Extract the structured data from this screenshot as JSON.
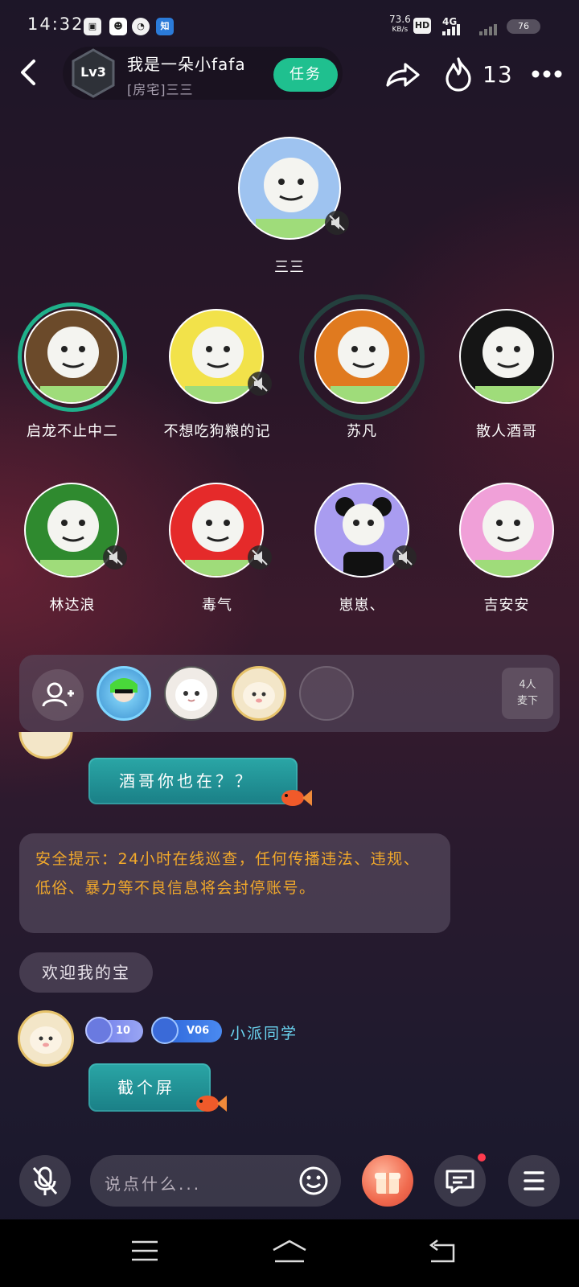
{
  "status_bar": {
    "time": "14:32",
    "net_speed": "73.6",
    "net_unit": "KB/s",
    "hd_label": "HD",
    "network_label": "4G",
    "battery": "76"
  },
  "header": {
    "level": "Lv3",
    "room_title": "我是一朵小fafa",
    "room_subtitle": "[房宅]三三",
    "task_label": "任务",
    "heat_count": "13"
  },
  "host": {
    "name": "三三"
  },
  "seats": [
    {
      "name": "启龙不止中二",
      "color": "#6b4a2a"
    },
    {
      "name": "不想吃狗粮的记",
      "color": "#f2e24a"
    },
    {
      "name": "苏凡",
      "color": "#e07a1f"
    },
    {
      "name": "散人酒哥",
      "color": "#151515"
    },
    {
      "name": "林达浪",
      "color": "#2f8a2f"
    },
    {
      "name": "毒气",
      "color": "#e52a2a"
    },
    {
      "name": "崽崽、",
      "color": "#a99cf0"
    },
    {
      "name": "吉安安",
      "color": "#f0a0d8"
    }
  ],
  "queue": {
    "count_line1": "4人",
    "count_line2": "麦下"
  },
  "chat": {
    "message1": "酒哥你也在？？",
    "safety_notice": "安全提示：24小时在线巡查，任何传播违法、违规、低俗、暴力等不良信息将会封停账号。",
    "welcome": "欢迎我的宝",
    "badge_level": "10",
    "badge_vip": "V06",
    "username": "小派同学",
    "message2": "截个屏"
  },
  "bottom_bar": {
    "input_placeholder": "说点什么..."
  },
  "colors": {
    "accent_green": "#1fc08f",
    "username_blue": "#6bd6f2",
    "notice_orange": "#f2a92b"
  }
}
